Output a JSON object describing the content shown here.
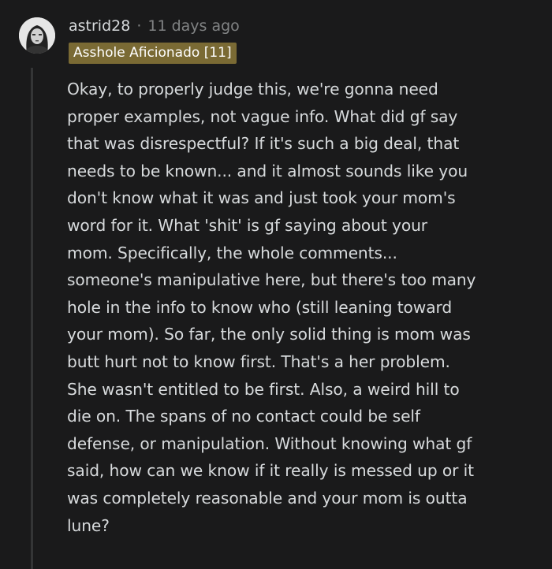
{
  "comment": {
    "author": "astrid28",
    "separator": "·",
    "timestamp": "11 days ago",
    "flair": "Asshole Aficionado [11]",
    "avatar_icon": "user-avatar-icon",
    "body_lines": [
      "Okay, to properly judge this, we're gonna need",
      "proper examples, not vague info. What did gf say",
      "that was disrespectful? If it's such a big deal, that",
      "needs to be known... and it almost sounds like you",
      "don't know what it was and just took your mom's",
      "word for it. What 'shit' is gf saying about your",
      "mom. Specifically, the whole comments...",
      "someone's manipulative here, but there's too many",
      "hole in the info to know who (still leaning toward",
      "your mom). So far, the only solid thing is mom was",
      "butt hurt not to know first. That's a her problem.",
      "She wasn't entitled to be first. Also, a weird hill to",
      "die on. The spans of no contact could be self",
      "defense, or manipulation. Without knowing what gf",
      "said, how can we know if it really is messed up or it",
      "was completely reasonable and your mom is outta",
      "lune?"
    ]
  },
  "colors": {
    "background": "#1a1a1b",
    "text": "#d7dadc",
    "meta": "#818384",
    "flair_bg": "#7a6a34",
    "thread_line": "#343536"
  }
}
